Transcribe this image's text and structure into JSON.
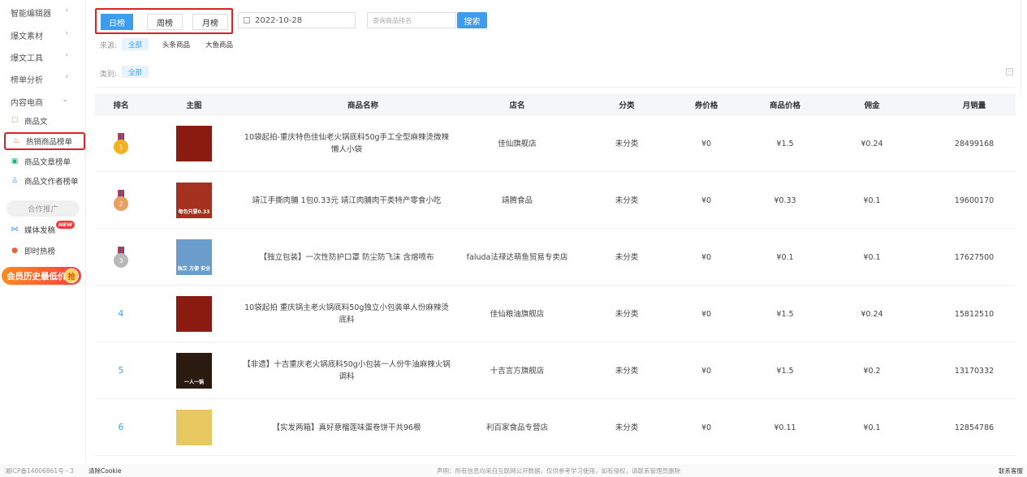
{
  "sidebar": {
    "items": [
      {
        "label": "智能编辑器",
        "chevron": "›"
      },
      {
        "label": "爆文素材",
        "chevron": "›"
      },
      {
        "label": "爆文工具",
        "chevron": "›"
      },
      {
        "label": "榜单分析",
        "chevron": "›"
      },
      {
        "label": "内容电商",
        "chevron": "⌄"
      }
    ],
    "sub_items": [
      {
        "label": "商品文",
        "icon": "☐",
        "color": "#f0a030"
      },
      {
        "label": "热销商品榜单",
        "icon": "♨",
        "color": "#f06030"
      },
      {
        "label": "商品文章榜单",
        "icon": "▣",
        "color": "#20b080"
      },
      {
        "label": "商品文作者榜单",
        "icon": "♙",
        "color": "#3c9df0"
      }
    ],
    "promo_label": "合作推广",
    "media_label": "媒体发稿",
    "new_badge": "NEW",
    "hot_label": "即时热榜",
    "vip_label": "会员历史最低价",
    "vip_grab": "抢"
  },
  "toolbar": {
    "periods": [
      "日榜",
      "周榜",
      "月榜"
    ],
    "date": "2022-10-28",
    "search_placeholder": "查询商品排名",
    "search_label": "搜索"
  },
  "filters": {
    "source_label": "来源:",
    "source_chips": [
      "全部",
      "头条商品",
      "大鱼商品"
    ],
    "category_label": "类别:",
    "category_chips": [
      "全部"
    ]
  },
  "table": {
    "headers": [
      "排名",
      "主图",
      "商品名称",
      "店名",
      "分类",
      "券价格",
      "商品价格",
      "佣金",
      "月销量"
    ],
    "rows": [
      {
        "rank": "1",
        "name": "10袋起拍-重庆特色佳仙老火锅底料50g手工全型麻辣烫微辣懒人小袋",
        "shop": "佳仙旗舰店",
        "category": "未分类",
        "coupon": "¥0",
        "price": "¥1.5",
        "commission": "¥0.24",
        "sales": "28499168",
        "thumb_text": "",
        "thumb_color": "#8b1a10"
      },
      {
        "rank": "2",
        "name": "靖江手撕肉脯 1包0.33元 靖江肉脯肉干类特产零食小吃",
        "shop": "靖腾食品",
        "category": "未分类",
        "coupon": "¥0",
        "price": "¥0.33",
        "commission": "¥0.1",
        "sales": "19600170",
        "thumb_text": "每包只要0.33",
        "thumb_color": "#a3311d"
      },
      {
        "rank": "3",
        "name": "【独立包装】一次性防护口罩 防尘防飞沫 含熔喷布",
        "shop": "faluda法禄达萌鱼贸易专卖店",
        "category": "未分类",
        "coupon": "¥0",
        "price": "¥0.1",
        "commission": "¥0.1",
        "sales": "17627500",
        "thumb_text": "独立 方便 安全",
        "thumb_color": "#6a9ccc"
      },
      {
        "rank": "4",
        "name": "10袋起拍 重庆锅主老火锅底料50g独立小包装单人份麻辣烫底料",
        "shop": "佳仙粮油旗舰店",
        "category": "未分类",
        "coupon": "¥0",
        "price": "¥1.5",
        "commission": "¥0.24",
        "sales": "15812510",
        "thumb_text": "",
        "thumb_color": "#8b1a10"
      },
      {
        "rank": "5",
        "name": "【非遗】十吉重庆老火锅底料50g小包装一人份牛油麻辣火锅调料",
        "shop": "十吉言方旗舰店",
        "category": "未分类",
        "coupon": "¥0",
        "price": "¥1.5",
        "commission": "¥0.2",
        "sales": "13170332",
        "thumb_text": "一人一锅",
        "thumb_color": "#2a1a10"
      },
      {
        "rank": "6",
        "name": "【实发两箱】真好意榴莲味蛋卷饼干共96根",
        "shop": "利百家食品专营店",
        "category": "未分类",
        "coupon": "¥0",
        "price": "¥0.11",
        "commission": "¥0.1",
        "sales": "12854786",
        "thumb_text": "",
        "thumb_color": "#e8c860"
      }
    ]
  },
  "medal_colors": {
    "gold": "#f3b21f",
    "silver-bronze": "#e8a060",
    "silver": "#b8b8b8"
  },
  "footer": {
    "icp": "湘ICP备14006861号 - 3",
    "clear_cookie": "清除Cookie",
    "notice": "声明：所有信息均来自互联网公开数据，仅供参考学习使用，如有侵权，请联系管理员删除",
    "contact": "联系客服"
  }
}
